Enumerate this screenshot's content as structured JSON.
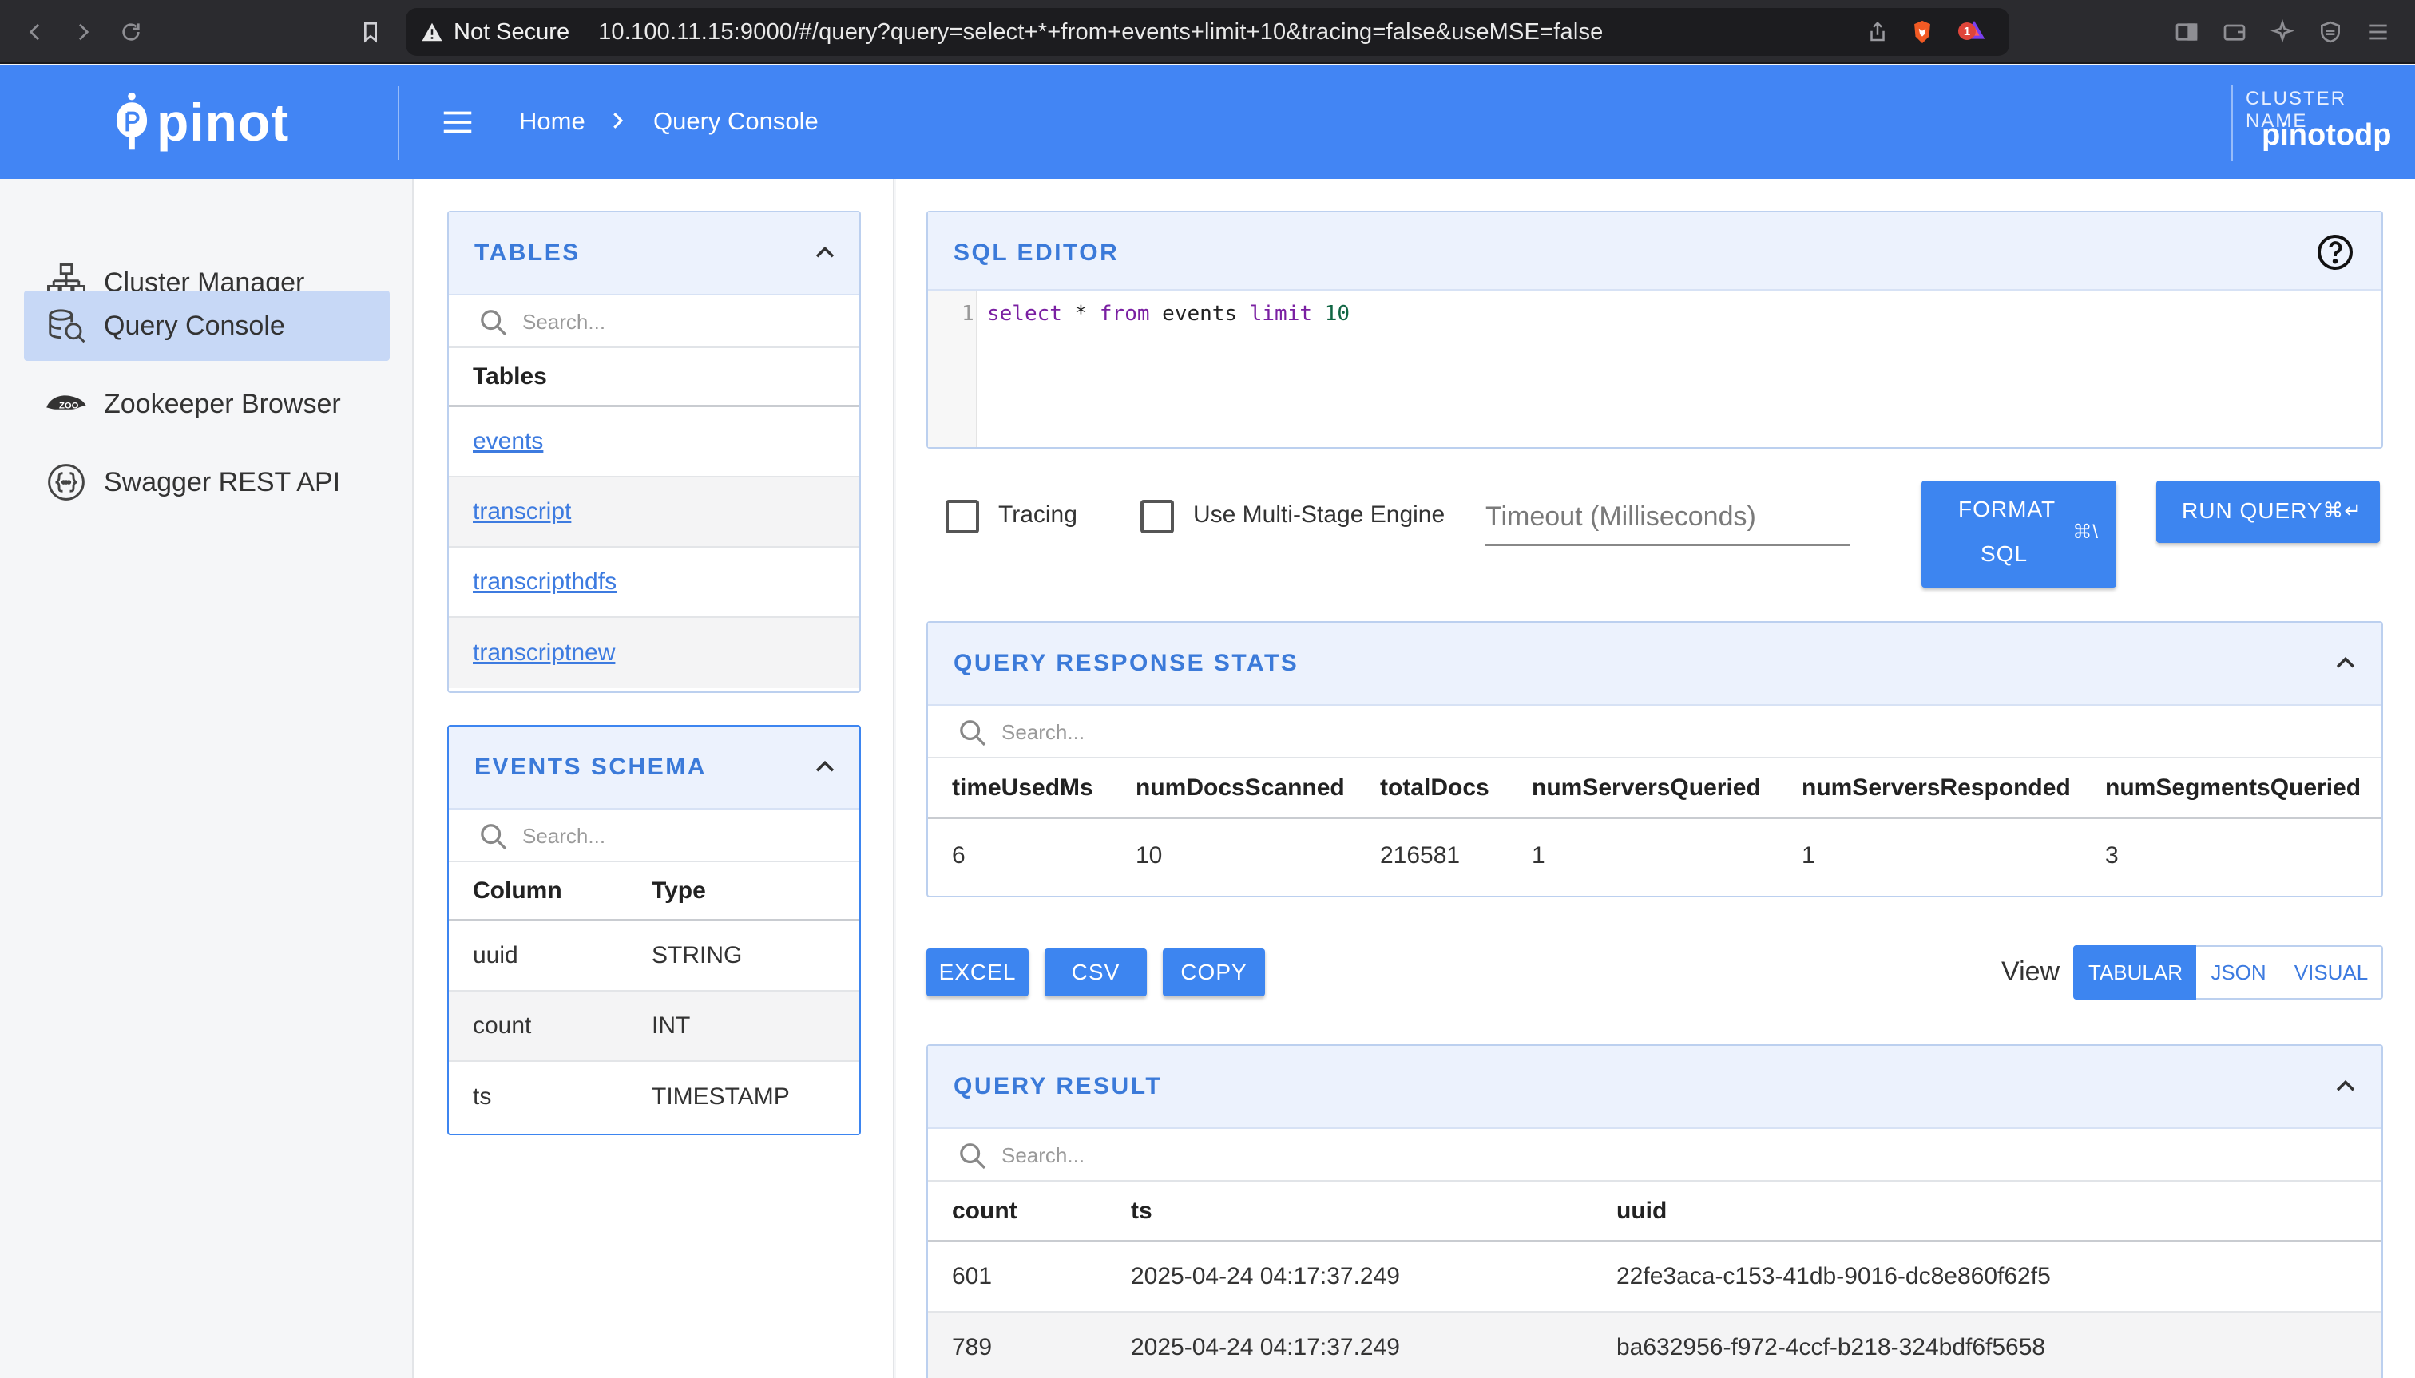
{
  "browser": {
    "security_label": "Not Secure",
    "url": "10.100.11.15:9000/#/query?query=select+*+from+events+limit+10&tracing=false&useMSE=false",
    "badge_count": "1"
  },
  "header": {
    "logo_text": "pinot",
    "breadcrumb": {
      "home": "Home",
      "current": "Query Console"
    },
    "cluster_label": "CLUSTER NAME",
    "cluster_name": "pinotodp",
    "accent_color": "#4285f4"
  },
  "sidebar": {
    "items": [
      {
        "label": "Cluster Manager",
        "icon": "cluster-icon"
      },
      {
        "label": "Query Console",
        "icon": "query-icon",
        "active": true
      },
      {
        "label": "Zookeeper Browser",
        "icon": "zookeeper-icon"
      },
      {
        "label": "Swagger REST API",
        "icon": "api-icon"
      }
    ]
  },
  "tables_panel": {
    "title": "TABLES",
    "search_placeholder": "Search...",
    "column_header": "Tables",
    "tables": [
      "events",
      "transcript",
      "transcripthdfs",
      "transcriptnew"
    ]
  },
  "schema_panel": {
    "title": "EVENTS SCHEMA",
    "search_placeholder": "Search...",
    "headers": [
      "Column",
      "Type"
    ],
    "rows": [
      [
        "uuid",
        "STRING"
      ],
      [
        "count",
        "INT"
      ],
      [
        "ts",
        "TIMESTAMP"
      ]
    ]
  },
  "sql_editor": {
    "title": "SQL EDITOR",
    "line_number": "1",
    "query_tokens": {
      "select": "select",
      "star": " * ",
      "from": "from",
      "table": " events ",
      "limit": "limit",
      "space": " ",
      "count": "10"
    }
  },
  "options": {
    "tracing_label": "Tracing",
    "multistage_label": "Use Multi-Stage Engine",
    "timeout_placeholder": "Timeout (Milliseconds)",
    "format_button_line1": "FORMAT",
    "format_button_line2": "SQL",
    "format_shortcut": "⌘\\",
    "run_button": "RUN QUERY",
    "run_shortcut": "⌘↵"
  },
  "stats_panel": {
    "title": "QUERY RESPONSE STATS",
    "search_placeholder": "Search...",
    "headers": [
      "timeUsedMs",
      "numDocsScanned",
      "totalDocs",
      "numServersQueried",
      "numServersResponded",
      "numSegmentsQueried"
    ],
    "values": [
      "6",
      "10",
      "216581",
      "1",
      "1",
      "3"
    ]
  },
  "export": {
    "excel": "EXCEL",
    "csv": "CSV",
    "copy": "COPY",
    "view_label": "View",
    "views": [
      "TABULAR",
      "JSON",
      "VISUAL"
    ],
    "active_view": "TABULAR"
  },
  "result_panel": {
    "title": "QUERY RESULT",
    "search_placeholder": "Search...",
    "headers": [
      "count",
      "ts",
      "uuid"
    ],
    "rows": [
      [
        "601",
        "2025-04-24 04:17:37.249",
        "22fe3aca-c153-41db-9016-dc8e860f62f5"
      ],
      [
        "789",
        "2025-04-24 04:17:37.249",
        "ba632956-f972-4ccf-b218-324bdf6f5658"
      ]
    ]
  }
}
